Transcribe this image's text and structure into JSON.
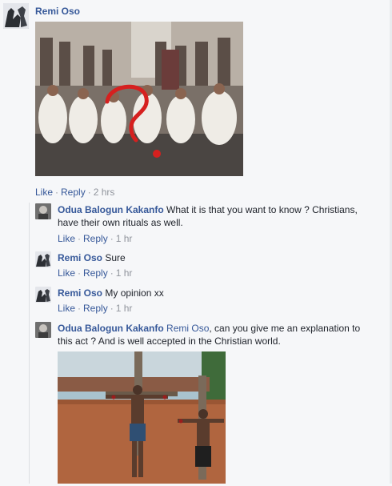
{
  "top_comment": {
    "author": "Remi Oso",
    "actions": {
      "like": "Like",
      "reply": "Reply",
      "time": "2 hrs"
    }
  },
  "replies": [
    {
      "author": "Odua Balogun Kakanfo",
      "text": "What it is that you want to know ? Christians, have their own rituals as well.",
      "actions": {
        "like": "Like",
        "reply": "Reply",
        "time": "1 hr"
      }
    },
    {
      "author": "Remi Oso",
      "text": "Sure",
      "actions": {
        "like": "Like",
        "reply": "Reply",
        "time": "1 hr"
      }
    },
    {
      "author": "Remi Oso",
      "text": "My opinion xx",
      "actions": {
        "like": "Like",
        "reply": "Reply",
        "time": "1 hr"
      }
    },
    {
      "author": "Odua Balogun Kakanfo",
      "mention": "Remi Oso",
      "text": ", can you give me an explanation to this act ? And is well accepted in the Christian world.",
      "actions": null
    }
  ],
  "colors": {
    "link": "#365899",
    "meta": "#90949c",
    "background": "#f6f7f9",
    "question_mark": "#d6201f"
  }
}
